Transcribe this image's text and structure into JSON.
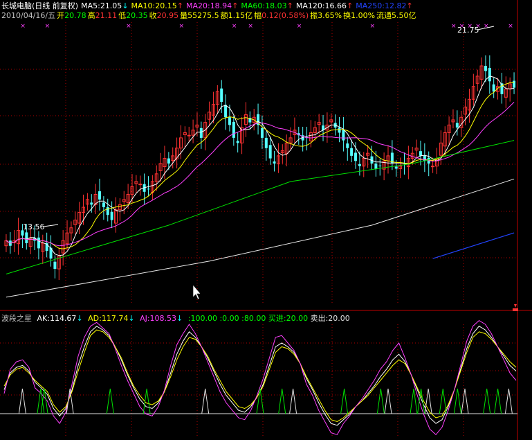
{
  "header1": {
    "title": "长城电脑(日线 前复权)",
    "ma": [
      {
        "label": "MA5:21.05",
        "color": "#ffffff",
        "arrow": "↓",
        "arrow_color": "#00ffff"
      },
      {
        "label": "MA10:20.15",
        "color": "#ffff00",
        "arrow": "↑",
        "arrow_color": "#ff3333"
      },
      {
        "label": "MA20:18.94",
        "color": "#ff40ff",
        "arrow": "↑",
        "arrow_color": "#ff3333"
      },
      {
        "label": "MA60:18.03",
        "color": "#00ff00",
        "arrow": "↑",
        "arrow_color": "#ff3333"
      },
      {
        "label": "MA120:16.66",
        "color": "#ffffff",
        "arrow": "↑",
        "arrow_color": "#ff3333"
      },
      {
        "label": "MA250:12.82",
        "color": "#2244ff",
        "arrow": "↑",
        "arrow_color": "#ff3333"
      }
    ]
  },
  "header2": {
    "date": "2010/04/16/五",
    "items": [
      {
        "k": "开",
        "v": "20.78",
        "kc": "#ffff00",
        "vc": "#00ff00"
      },
      {
        "k": "高",
        "v": "21.11",
        "kc": "#ffff00",
        "vc": "#ff3333"
      },
      {
        "k": "低",
        "v": "20.35",
        "kc": "#ffff00",
        "vc": "#00ff00"
      },
      {
        "k": "收",
        "v": "20.95",
        "kc": "#ffff00",
        "vc": "#ff3333"
      },
      {
        "k": "量",
        "v": "55275.5",
        "kc": "#ffff00",
        "vc": "#ffff00"
      },
      {
        "k": "额",
        "v": "1.15亿",
        "kc": "#ffff00",
        "vc": "#ffff00"
      },
      {
        "k": "幅",
        "v": "0.12(0.58%)",
        "kc": "#ffff00",
        "vc": "#ff3333"
      },
      {
        "k": "振",
        "v": "3.65%",
        "kc": "#ffff00",
        "vc": "#ffff00"
      },
      {
        "k": "换",
        "v": "1.00%",
        "kc": "#ffff00",
        "vc": "#ffff00"
      },
      {
        "k": "流通",
        "v": "5.50亿",
        "kc": "#ffff00",
        "vc": "#ffff00"
      }
    ]
  },
  "header3": {
    "name": "波段之星",
    "ak": "AK:114.67",
    "ad": "AD:117.74",
    "aj": "AJ:108.53",
    "v1": ":100.00",
    "v2": ":0.00",
    "v3": ":80.00",
    "buy": "买进:20.00",
    "sell": "卖出:20.00",
    "ak_arrow": "↓",
    "ad_arrow": "↓",
    "aj_arrow": "↓"
  },
  "annotations": {
    "high_label": "21.75",
    "low_label": "13.56"
  },
  "colors": {
    "up": "#ff3232",
    "down": "#54ffff",
    "ma5": "#ffffff",
    "ma10": "#ffff00",
    "ma20": "#ff40ff",
    "ma60": "#00e000",
    "ma120": "#e8e8e8",
    "ma250": "#2244ff",
    "grid": "#b00000",
    "ak": "#ffffff",
    "ad": "#ffff00",
    "aj": "#ff40ff"
  },
  "chart_data": [
    {
      "type": "candlestick",
      "ylim": [
        12.5,
        23.5
      ],
      "count": 126,
      "seed_close": [
        15.0,
        14.8,
        15.0,
        15.4,
        15.2,
        14.9,
        15.1,
        15.0,
        14.7,
        14.9,
        14.6,
        14.3,
        13.9,
        14.4,
        15.0,
        15.3,
        15.5,
        15.8,
        16.1,
        16.3,
        16.6,
        16.4,
        16.8,
        16.6,
        16.3,
        16.0,
        15.8,
        16.2,
        16.4,
        16.6,
        16.8,
        17.1,
        17.3,
        17.2,
        16.9,
        17.0,
        17.3,
        17.6,
        18.0,
        18.2,
        18.0,
        18.3,
        18.6,
        19.0,
        19.2,
        19.1,
        19.3,
        19.5,
        19.0,
        19.6,
        20.0,
        20.3,
        20.8,
        20.4,
        19.8,
        19.5,
        19.0,
        18.8,
        19.4,
        19.9,
        19.6,
        19.8,
        19.5,
        19.0,
        18.6,
        18.2,
        18.0,
        18.3,
        18.5,
        18.8,
        19.0,
        19.3,
        19.1,
        18.9,
        19.0,
        19.2,
        19.4,
        19.6,
        19.3,
        19.5,
        19.7,
        19.4,
        19.2,
        18.9,
        18.6,
        18.3,
        18.1,
        17.9,
        18.2,
        18.4,
        18.0,
        17.8,
        17.9,
        18.1,
        18.3,
        18.0,
        17.8,
        17.9,
        18.0,
        18.2,
        18.4,
        18.6,
        18.3,
        18.1,
        18.0,
        17.9,
        18.2,
        18.8,
        19.2,
        19.5,
        19.7,
        19.4,
        19.8,
        20.2,
        20.5,
        21.0,
        21.4,
        21.8,
        21.6,
        21.2,
        20.8,
        21.0,
        20.7,
        20.9,
        21.1,
        20.95
      ],
      "ma60": [
        {
          "i": 0,
          "v": 13.7
        },
        {
          "i": 40,
          "v": 15.6
        },
        {
          "i": 70,
          "v": 17.3
        },
        {
          "i": 100,
          "v": 18.0
        },
        {
          "i": 125,
          "v": 18.9
        }
      ],
      "ma120": [
        {
          "i": 0,
          "v": 12.8
        },
        {
          "i": 50,
          "v": 14.2
        },
        {
          "i": 90,
          "v": 15.6
        },
        {
          "i": 125,
          "v": 17.4
        }
      ],
      "ma250": [
        {
          "i": 105,
          "v": 14.3
        },
        {
          "i": 125,
          "v": 15.3
        }
      ],
      "high": {
        "i": 118,
        "v": 21.75
      },
      "low": {
        "i": 13,
        "v": 13.56
      }
    },
    {
      "type": "line",
      "ylim": [
        -10,
        110
      ],
      "series": [
        {
          "name": "AK",
          "values": [
            40,
            58,
            64,
            66,
            60,
            48,
            42,
            35,
            20,
            12,
            20,
            40,
            66,
            86,
            102,
            108,
            104,
            98,
            86,
            72,
            56,
            42,
            30,
            22,
            20,
            26,
            38,
            58,
            78,
            92,
            102,
            96,
            86,
            74,
            60,
            46,
            34,
            26,
            18,
            16,
            22,
            32,
            46,
            66,
            86,
            90,
            86,
            80,
            68,
            52,
            40,
            26,
            14,
            4,
            2,
            8,
            14,
            22,
            28,
            36,
            44,
            54,
            62,
            72,
            78,
            70,
            56,
            40,
            24,
            10,
            4,
            8,
            22,
            40,
            62,
            84,
            100,
            108,
            104,
            96,
            86,
            76,
            66,
            60
          ]
        },
        {
          "name": "AD",
          "values": [
            44,
            56,
            62,
            64,
            58,
            50,
            44,
            38,
            24,
            16,
            22,
            38,
            60,
            80,
            98,
            104,
            102,
            96,
            86,
            74,
            58,
            44,
            34,
            26,
            24,
            28,
            38,
            54,
            72,
            86,
            96,
            94,
            86,
            76,
            62,
            50,
            38,
            30,
            22,
            20,
            24,
            32,
            44,
            62,
            80,
            86,
            84,
            78,
            68,
            54,
            42,
            30,
            18,
            8,
            6,
            10,
            16,
            22,
            28,
            34,
            42,
            50,
            58,
            66,
            72,
            68,
            56,
            42,
            28,
            16,
            10,
            12,
            24,
            40,
            60,
            80,
            96,
            102,
            100,
            94,
            86,
            78,
            70,
            64
          ]
        },
        {
          "name": "AJ",
          "values": [
            36,
            62,
            70,
            72,
            64,
            42,
            36,
            28,
            12,
            4,
            16,
            46,
            76,
            96,
            108,
            112,
            106,
            100,
            84,
            66,
            50,
            36,
            22,
            14,
            12,
            22,
            40,
            66,
            88,
            100,
            110,
            100,
            86,
            70,
            54,
            38,
            26,
            18,
            10,
            8,
            18,
            34,
            52,
            74,
            96,
            98,
            90,
            82,
            68,
            46,
            34,
            18,
            6,
            -6,
            -8,
            4,
            12,
            22,
            30,
            40,
            50,
            62,
            70,
            82,
            90,
            74,
            56,
            34,
            14,
            -2,
            -8,
            0,
            18,
            40,
            66,
            92,
            108,
            114,
            110,
            100,
            86,
            72,
            58,
            50
          ]
        }
      ],
      "spike_positions": [
        5,
        10,
        11,
        18,
        29,
        39,
        55,
        70,
        76,
        79,
        93,
        103,
        105,
        112,
        114,
        116,
        120,
        124,
        126,
        132,
        135,
        138
      ]
    }
  ]
}
